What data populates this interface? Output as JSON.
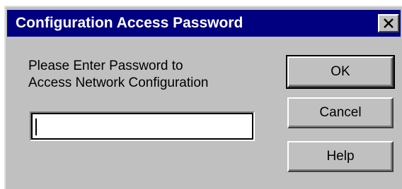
{
  "window": {
    "title": "Configuration Access Password",
    "close_icon": "close-icon"
  },
  "prompt": {
    "line1": "Please Enter Password to",
    "line2": "Access Network Configuration"
  },
  "password_field": {
    "value": ""
  },
  "buttons": {
    "ok_label": "OK",
    "cancel_label": "Cancel",
    "help_label": "Help"
  },
  "colors": {
    "titlebar": "#000080",
    "dialog_face": "#c0c0c0"
  }
}
